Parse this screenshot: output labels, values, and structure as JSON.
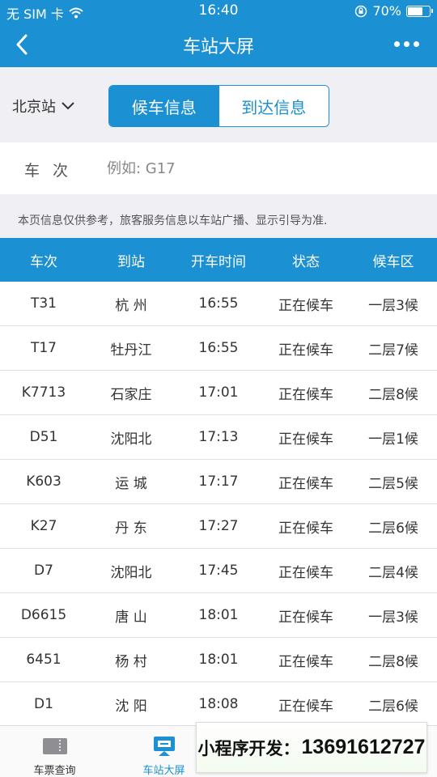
{
  "status_bar": {
    "carrier": "无 SIM 卡",
    "time": "16:40",
    "battery_percent": "70%",
    "battery_level": 0.7,
    "icons": [
      "wifi-icon",
      "rotation-lock-icon",
      "battery-icon"
    ]
  },
  "navbar": {
    "title": "车站大屏",
    "back_icon": "chevron-left-icon",
    "more_icon": "more-dots-icon"
  },
  "selector": {
    "station": "北京站",
    "segments": [
      {
        "label": "候车信息",
        "active": true
      },
      {
        "label": "到达信息",
        "active": false
      }
    ]
  },
  "search": {
    "label": "车 次",
    "placeholder": "例如: G17",
    "value": ""
  },
  "notice": "本页信息仅供参考，旅客服务信息以车站广播、显示引导为准.",
  "table": {
    "headers": [
      "车次",
      "到站",
      "开车时间",
      "状态",
      "候车区"
    ],
    "rows": [
      [
        "T31",
        "杭 州",
        "16:55",
        "正在候车",
        "一层3候"
      ],
      [
        "T17",
        "牡丹江",
        "16:55",
        "正在候车",
        "二层7候"
      ],
      [
        "K7713",
        "石家庄",
        "17:01",
        "正在候车",
        "二层8候"
      ],
      [
        "D51",
        "沈阳北",
        "17:13",
        "正在候车",
        "一层1候"
      ],
      [
        "K603",
        "运 城",
        "17:17",
        "正在候车",
        "二层5候"
      ],
      [
        "K27",
        "丹 东",
        "17:27",
        "正在候车",
        "二层6候"
      ],
      [
        "D7",
        "沈阳北",
        "17:45",
        "正在候车",
        "二层4候"
      ],
      [
        "D6615",
        "唐 山",
        "18:01",
        "正在候车",
        "一层3候"
      ],
      [
        "6451",
        "杨 村",
        "18:01",
        "正在候车",
        "二层8候"
      ],
      [
        "D1",
        "沈 阳",
        "18:08",
        "正在候车",
        "二层6候"
      ]
    ]
  },
  "tabbar": {
    "items": [
      {
        "label": "车票查询",
        "icon": "ticket-icon",
        "active": false
      },
      {
        "label": "车站大屏",
        "icon": "monitor-icon",
        "active": true
      },
      {
        "label": "",
        "icon": "",
        "active": false
      },
      {
        "label": "",
        "icon": "",
        "active": false
      }
    ]
  },
  "watermark": {
    "prefix": "小程序开发：",
    "number": "13691612727"
  },
  "colors": {
    "primary": "#1b90d2",
    "background": "#efeff4"
  }
}
